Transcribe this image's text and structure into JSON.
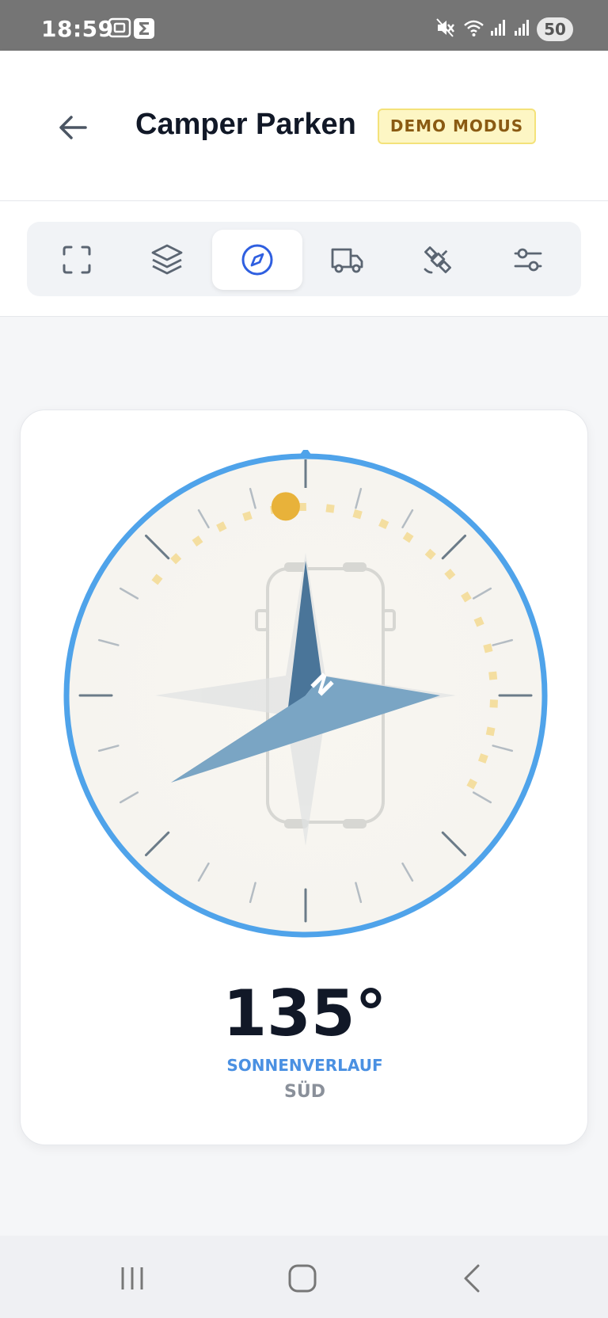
{
  "status_bar": {
    "time": "18:59",
    "battery": "50",
    "icons": [
      "screenshot-icon",
      "sigma-app-icon",
      "mute-icon",
      "wifi-icon",
      "signal-icon",
      "signal-icon"
    ]
  },
  "header": {
    "back_icon": "arrow-left-icon",
    "title": "Camper Parken",
    "badge": "DEMO MODUS"
  },
  "tabs": [
    {
      "icon": "fullscreen-frame-icon",
      "active": false
    },
    {
      "icon": "layers-icon",
      "active": false
    },
    {
      "icon": "compass-icon",
      "active": true
    },
    {
      "icon": "truck-icon",
      "active": false
    },
    {
      "icon": "satellite-icon",
      "active": false
    },
    {
      "icon": "sliders-icon",
      "active": false
    }
  ],
  "compass": {
    "heading": "135°",
    "heading_degrees": 135,
    "mode": "SONNENVERLAUF",
    "direction": "SÜD",
    "needle_letter": "N"
  },
  "colors": {
    "accent_blue": "#4fa3ea",
    "needle_dark": "#4a7599",
    "needle_light": "#7aa5c4",
    "sun": "#e8b23a",
    "sun_path": "#f4dea0",
    "badge_bg": "#fdf6c4",
    "badge_text": "#8a5a12"
  },
  "nav": {
    "icons": [
      "recent-apps-icon",
      "home-icon",
      "back-icon"
    ]
  }
}
